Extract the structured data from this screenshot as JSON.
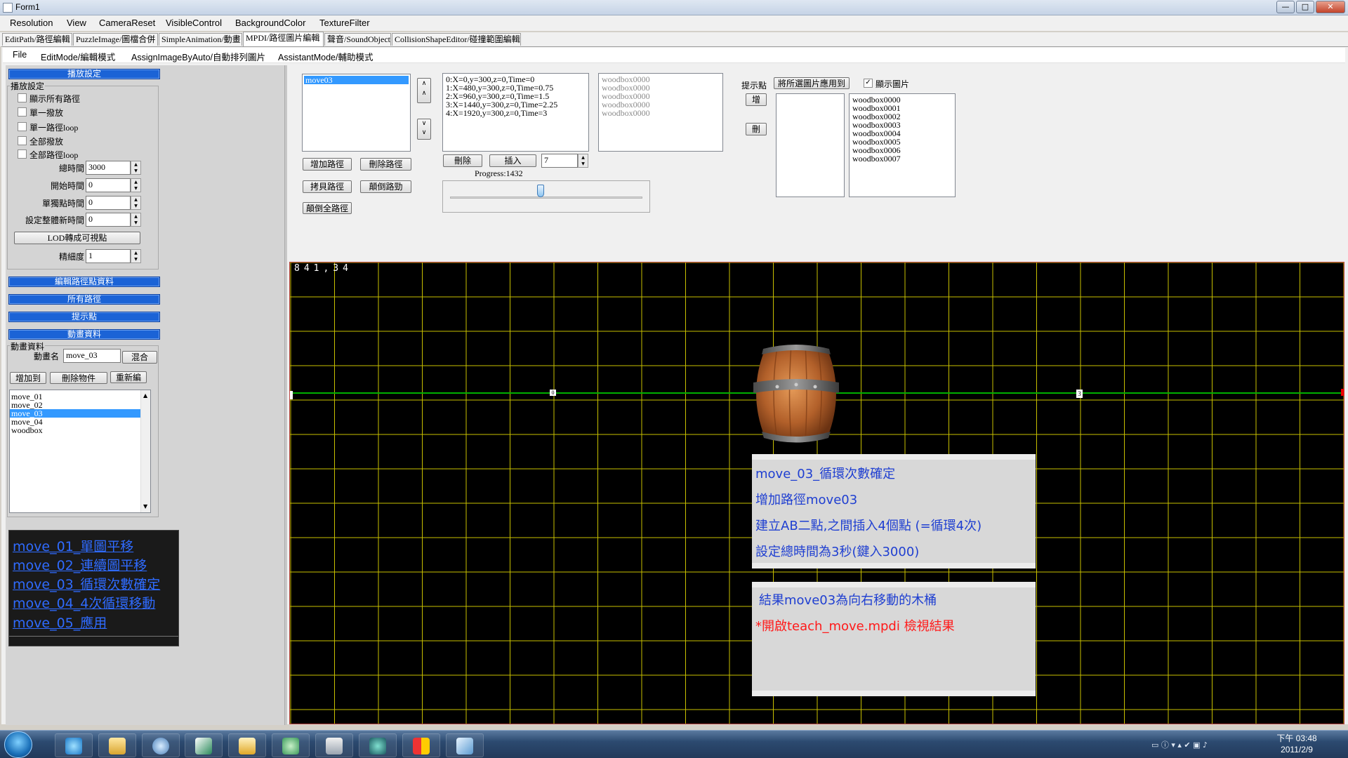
{
  "window": {
    "title": "Form1"
  },
  "menubar": [
    "Resolution",
    "View",
    "CameraReset",
    "VisibleControl",
    "BackgroundColor",
    "TextureFilter"
  ],
  "tabs": [
    "EditPath/路徑編輯",
    "PuzzleImage/圖檔合併",
    "SimpleAnimation/動畫",
    "MPDI/路徑圖片編輯",
    "聲音/SoundObject",
    "CollisionShapeEditor/碰撞範圍編輯"
  ],
  "active_tab_index": 3,
  "submenu": [
    "File",
    "EditMode/編輯模式",
    "AssignImageByAuto/自動排列圖片",
    "AssistantMode/輔助模式"
  ],
  "left": {
    "playback_bar": "播放設定",
    "playback_group": "播放設定",
    "checkboxes": [
      "顯示所有路徑",
      "單一撥放",
      "單一路徑loop",
      "全部撥放",
      "全部路徑loop"
    ],
    "fields": [
      {
        "label": "總時間",
        "value": "3000"
      },
      {
        "label": "開始時間",
        "value": "0"
      },
      {
        "label": "單獨點時間",
        "value": "0"
      },
      {
        "label": "設定整體新時間",
        "value": "0"
      }
    ],
    "lod_button": "LOD轉成可視點",
    "precision_label": "精細度",
    "precision_value": "1",
    "bars": [
      "編輯路徑點資料",
      "所有路徑",
      "提示點",
      "動畫資料"
    ],
    "anim_group": "動畫資料",
    "anim_name_label": "動畫名",
    "anim_name_value": "move_03",
    "mix_button": "混合",
    "add_to_button": "增加到",
    "delete_object_button": "刪除物件",
    "re_edit_button": "重新編",
    "anim_list": [
      "move_01",
      "move_02",
      "move_03",
      "move_04",
      "woodbox"
    ],
    "anim_selected": 2,
    "captions": [
      "move_01_單圖平移",
      "move_02_連續圖平移",
      "move_03_循環次數確定",
      "move_04_4次循環移動",
      "move_05_應用"
    ]
  },
  "ctrl": {
    "path_list": [
      "move03"
    ],
    "up_arrow": "∧",
    "down_arrow": "∨",
    "add_path": "增加路徑",
    "delete_path": "刪除路徑",
    "copy_path": "拷貝路徑",
    "reverse_path": "顛倒路勁",
    "reverse_all": "顛倒全路徑",
    "points": [
      "0:X=0,y=300,z=0,Time=0",
      "1:X=480,y=300,z=0,Time=0.75",
      "2:X=960,y=300,z=0,Time=1.5",
      "3:X=1440,y=300,z=0,Time=2.25",
      "4:X=1920,y=300,z=0,Time=3"
    ],
    "delete_btn": "刪除",
    "insert_btn": "插入",
    "insert_count": "7",
    "progress_label": "Progress:1432",
    "slider_fraction": 0.47,
    "gray_images": [
      "woodbox0000",
      "woodbox0000",
      "woodbox0000",
      "woodbox0000",
      "woodbox0000"
    ],
    "hint_label": "提示點",
    "apply_images_btn": "將所選圖片應用到",
    "show_image_label": "顯示圖片",
    "add_btn": "增",
    "del_btn": "刪",
    "image_list": [
      "woodbox0000",
      "woodbox0001",
      "woodbox0002",
      "woodbox0003",
      "woodbox0004",
      "woodbox0005",
      "woodbox0006",
      "woodbox0007"
    ]
  },
  "canvas": {
    "coord": "841,34",
    "point_markers": [
      "0",
      "3"
    ],
    "note1": [
      "move_03_循環次數確定",
      "增加路徑move03",
      "建立AB二點,之間插入4個點 (=循環4次)",
      "設定總時間為3秒(鍵入3000)"
    ],
    "note2": [
      "結果move03為向右移動的木桶",
      "*開啟teach_move.mpdi 檢視結果"
    ]
  },
  "taskbar": {
    "time": "下午 03:48",
    "date": "2011/2/9"
  },
  "colors": {
    "grid": "#c8c000",
    "path": "#00b000",
    "accent": "#1b63d6",
    "caption": "#2f6bff",
    "note": "#1f3fd1",
    "note_red": "#ff1a1a"
  }
}
